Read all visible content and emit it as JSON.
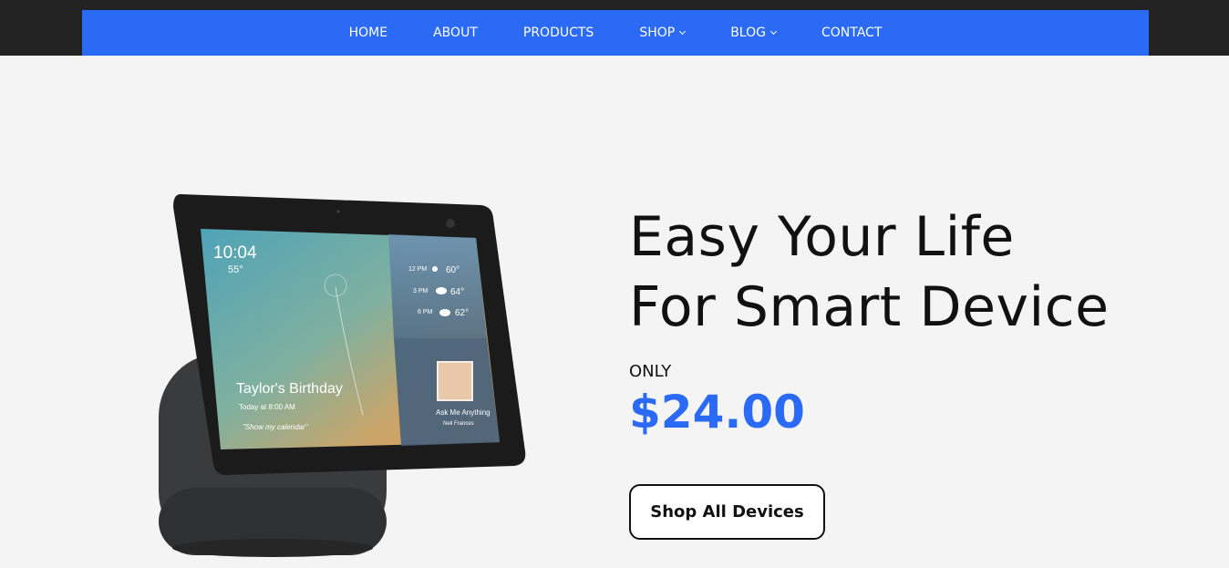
{
  "nav": {
    "items": [
      {
        "label": "HOME"
      },
      {
        "label": "ABOUT"
      },
      {
        "label": "PRODUCTS"
      },
      {
        "label": "SHOP"
      },
      {
        "label": "BLOG"
      },
      {
        "label": "CONTACT"
      }
    ]
  },
  "hero": {
    "headline_line1": "Easy Your Life",
    "headline_line2": "For Smart Device",
    "only_label": "ONLY",
    "price": "$24.00",
    "cta_label": "Shop All Devices"
  },
  "device_screen": {
    "time": "10:04",
    "temp": "55°",
    "forecast": [
      {
        "time": "12 PM",
        "temp": "60°"
      },
      {
        "time": "3 PM",
        "temp": "64°"
      },
      {
        "time": "6 PM",
        "temp": "62°"
      }
    ],
    "event_title": "Taylor's Birthday",
    "event_time": "Today at 8:00 AM",
    "event_hint": "\"Show my calendar\"",
    "tile_title": "Ask Me Anything",
    "tile_author": "Neil Frances"
  },
  "colors": {
    "accent": "#2a6af5",
    "topbar": "#232323",
    "background": "#f4f4f4"
  }
}
